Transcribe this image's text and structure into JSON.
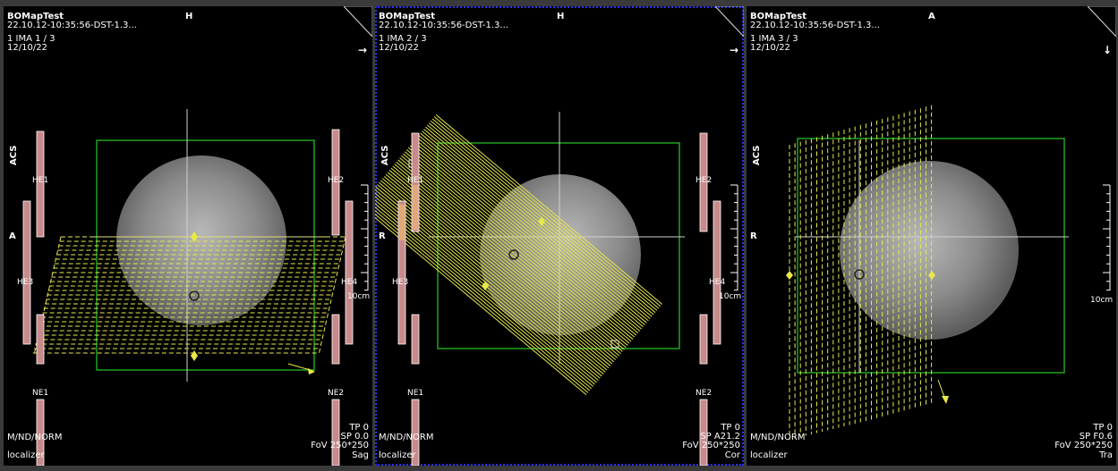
{
  "viewports": [
    {
      "patient": "BOMapTest",
      "series": "22.10.12-10:35:56-DST-1.3...",
      "image": "1 IMA 1 / 3",
      "date": "12/10/22",
      "orient_top": "H",
      "orient_left": "A",
      "side_label": "ACS",
      "arrow": "→",
      "coils": {
        "tl": "HE1",
        "tr": "HE2",
        "ml": "HE3",
        "mr": "HE4",
        "bl": "NE1",
        "br": "NE2"
      },
      "scale": "10cm",
      "tp": "TP 0",
      "sp": "SP  0.0",
      "fov": "FoV 250*250",
      "window": "M/ND/NORM",
      "type": "localizer",
      "plane": "Sag"
    },
    {
      "patient": "BOMapTest",
      "series": "22.10.12-10:35:56-DST-1.3...",
      "image": "1 IMA 2 / 3",
      "date": "12/10/22",
      "orient_top": "H",
      "orient_left": "R",
      "side_label": "ACS",
      "arrow": "→",
      "coils": {
        "tl": "HE1",
        "tr": "HE2",
        "ml": "HE3",
        "mr": "HE4",
        "bl": "NE1",
        "br": "NE2"
      },
      "scale": "10cm",
      "tp": "TP 0",
      "sp": "SP A21.2",
      "fov": "FoV 250*250",
      "window": "M/ND/NORM",
      "type": "localizer",
      "plane": "Cor"
    },
    {
      "patient": "BOMapTest",
      "series": "22.10.12-10:35:56-DST-1.3...",
      "image": "1 IMA 3 / 3",
      "date": "12/10/22",
      "orient_top": "A",
      "orient_left": "R",
      "side_label": "ACS",
      "arrow": "↓",
      "scale": "10cm",
      "tp": "TP 0",
      "sp": "SP F0.6",
      "fov": "FoV 250*250",
      "window": "M/ND/NORM",
      "type": "localizer",
      "plane": "Tra"
    }
  ],
  "colors": {
    "fov_box": "#1fa31f",
    "slab": "#e8e84a",
    "coil": "#c88a8a",
    "active_border": "#2d2dff"
  }
}
